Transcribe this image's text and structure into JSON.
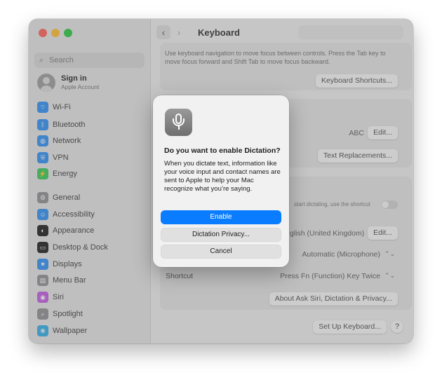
{
  "sidebar": {
    "search_placeholder": "Search",
    "account": {
      "name": "Sign in",
      "subtitle": "Apple Account"
    },
    "items": [
      {
        "label": "Wi-Fi",
        "icon": "wifi-icon",
        "color": "#2f8ff3",
        "glyph": "⌔"
      },
      {
        "label": "Bluetooth",
        "icon": "bluetooth-icon",
        "color": "#2f8ff3",
        "glyph": "ᛒ"
      },
      {
        "label": "Network",
        "icon": "globe-icon",
        "color": "#2f8ff3",
        "glyph": "◍"
      },
      {
        "label": "VPN",
        "icon": "vpn-icon",
        "color": "#2f8ff3",
        "glyph": "⛨"
      },
      {
        "label": "Energy",
        "icon": "energy-icon",
        "color": "#35c759",
        "glyph": "⚡"
      },
      {
        "label": "General",
        "icon": "gear-icon",
        "color": "#8e8e93",
        "glyph": "⚙"
      },
      {
        "label": "Accessibility",
        "icon": "accessibility-icon",
        "color": "#2f8ff3",
        "glyph": "☺"
      },
      {
        "label": "Appearance",
        "icon": "appearance-icon",
        "color": "#1c1c1e",
        "glyph": "◐"
      },
      {
        "label": "Desktop & Dock",
        "icon": "dock-icon",
        "color": "#1c1c1e",
        "glyph": "▭"
      },
      {
        "label": "Displays",
        "icon": "displays-icon",
        "color": "#2f8ff3",
        "glyph": "✷"
      },
      {
        "label": "Menu Bar",
        "icon": "menubar-icon",
        "color": "#8e8e93",
        "glyph": "▤"
      },
      {
        "label": "Siri",
        "icon": "siri-icon",
        "color": "#c05be0",
        "glyph": "◉"
      },
      {
        "label": "Spotlight",
        "icon": "spotlight-icon",
        "color": "#8e8e93",
        "glyph": "⌕"
      },
      {
        "label": "Wallpaper",
        "icon": "wallpaper-icon",
        "color": "#32ade6",
        "glyph": "❀"
      }
    ]
  },
  "header": {
    "title": "Keyboard",
    "back_icon": "chevron-left-icon",
    "forward_icon": "chevron-right-icon"
  },
  "content": {
    "nav_desc": "Use keyboard navigation to move focus between controls. Press the Tab key to move focus forward and Shift Tab to move focus backward.",
    "shortcuts_button": "Keyboard Shortcuts...",
    "input_source_value": "ABC",
    "edit_button": "Edit...",
    "text_replacements_button": "Text Replacements...",
    "dictation_hint": "start dictating, use the shortcut",
    "language_value": "glish (United Kingdom)",
    "language_edit_button": "Edit...",
    "mic_value": "Automatic (Microphone)",
    "shortcut_label": "Shortcut",
    "shortcut_value": "Press Fn (Function) Key Twice",
    "about_button": "About Ask Siri, Dictation & Privacy...",
    "setup_button": "Set Up Keyboard...",
    "help_button": "?"
  },
  "dialog": {
    "icon": "microphone-icon",
    "title": "Do you want to enable Dictation?",
    "body": "When you dictate text, information like your voice input and contact names are sent to Apple to help your Mac recognize what you’re saying.",
    "enable_button": "Enable",
    "privacy_button": "Dictation Privacy...",
    "cancel_button": "Cancel",
    "accent_color": "#0a7cff"
  }
}
